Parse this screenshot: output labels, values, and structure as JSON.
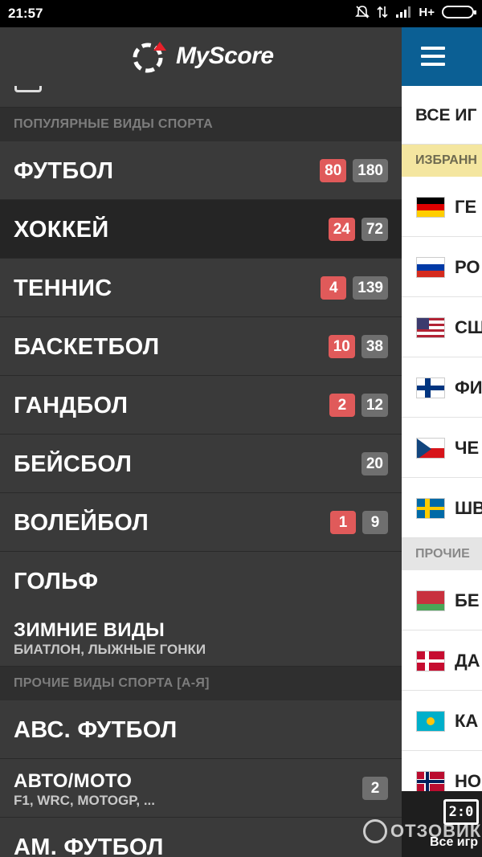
{
  "status_bar": {
    "time": "21:57",
    "network": "H+"
  },
  "background_app": {
    "all_games_label": "ВСЕ ИГ",
    "favorites_section": "ИЗБРАНН",
    "others_section": "ПРОЧИЕ",
    "countries": [
      {
        "name": "ГЕ",
        "flag": "germany"
      },
      {
        "name": "РО",
        "flag": "russia"
      },
      {
        "name": "СШ",
        "flag": "usa"
      },
      {
        "name": "ФИ",
        "flag": "finland"
      },
      {
        "name": "ЧЕ",
        "flag": "czech"
      },
      {
        "name": "ШВ",
        "flag": "sweden"
      },
      {
        "name": "БЕ",
        "flag": "belarus"
      },
      {
        "name": "ДА",
        "flag": "denmark"
      },
      {
        "name": "КА",
        "flag": "kazakhstan"
      },
      {
        "name": "НО",
        "flag": "norway"
      }
    ],
    "bottom_score_icon": "2:0",
    "bottom_label": "Все игр"
  },
  "drawer": {
    "logo_text": "MyScore",
    "popular_section": "ПОПУЛЯРНЫЕ ВИДЫ СПОРТА",
    "popular_sports": [
      {
        "name": "ФУТБОЛ",
        "live": "80",
        "total": "180",
        "active": false
      },
      {
        "name": "ХОККЕЙ",
        "live": "24",
        "total": "72",
        "active": true
      },
      {
        "name": "ТЕННИС",
        "live": "4",
        "total": "139",
        "active": false
      },
      {
        "name": "БАСКЕТБОЛ",
        "live": "10",
        "total": "38",
        "active": false
      },
      {
        "name": "ГАНДБОЛ",
        "live": "2",
        "total": "12",
        "active": false
      },
      {
        "name": "БЕЙСБОЛ",
        "live": "",
        "total": "20",
        "active": false
      },
      {
        "name": "ВОЛЕЙБОЛ",
        "live": "1",
        "total": "9",
        "active": false
      },
      {
        "name": "ГОЛЬФ",
        "live": "",
        "total": "",
        "active": false
      }
    ],
    "winter": {
      "name": "ЗИМНИЕ ВИДЫ",
      "subtitle": "БИАТЛОН, ЛЫЖНЫЕ ГОНКИ"
    },
    "other_section": "ПРОЧИЕ ВИДЫ СПОРТА [А-Я]",
    "other_sports": [
      {
        "name": "АВС. ФУТБОЛ",
        "subtitle": "",
        "total": ""
      },
      {
        "name": "АВТО/МОТО",
        "subtitle": "F1, WRC, MOTOGP, ...",
        "total": "2"
      },
      {
        "name": "АМ. ФУТБОЛ",
        "subtitle": "",
        "total": ""
      }
    ]
  },
  "watermark": "ОТЗОВИК",
  "colors": {
    "live_badge": "#e05a5a",
    "total_badge": "#6f6f6f",
    "accent_blue": "#0b5f94",
    "logo_red": "#e8202a"
  }
}
